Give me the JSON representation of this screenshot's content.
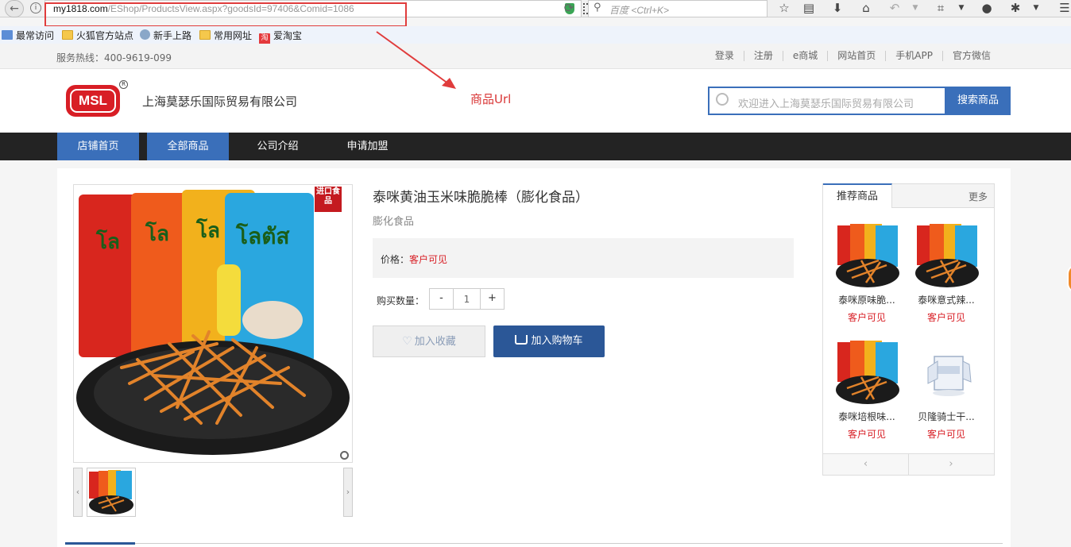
{
  "browser": {
    "url_host": "my1818.com",
    "url_path": "/EShop/ProductsView.aspx?goodsId=97406&Comid=1086",
    "search_placeholder": "百度 <Ctrl+K>"
  },
  "bookmarks": [
    {
      "label": "最常访问",
      "icon": "bookmark-icon"
    },
    {
      "label": "火狐官方站点",
      "icon": "folder-icon"
    },
    {
      "label": "新手上路",
      "icon": "globe-icon"
    },
    {
      "label": "常用网址",
      "icon": "folder-icon"
    },
    {
      "label": "爱淘宝",
      "icon": "taobao-icon"
    }
  ],
  "utility": {
    "hotline": "服务热线：400-9619-099",
    "links": [
      "登录",
      "注册",
      "e商城",
      "网站首页",
      "手机APP",
      "官方微信"
    ]
  },
  "header": {
    "logo_text": "MSL",
    "logo_reg": "R",
    "company_name": "上海莫瑟乐国际贸易有限公司",
    "annotation": "商品Url",
    "search_placeholder": "欢迎进入上海莫瑟乐国际贸易有限公司",
    "search_button": "搜索商品"
  },
  "nav": {
    "items": [
      "店铺首页",
      "全部商品",
      "公司介绍",
      "申请加盟"
    ],
    "active_index": 1
  },
  "product": {
    "badge": "进口食品",
    "title": "泰咪黄油玉米味脆脆棒（膨化食品）",
    "subtitle": "膨化食品",
    "price_label": "价格：",
    "price_value": "客户可见",
    "qty_label": "购买数量：",
    "qty_minus": "-",
    "qty_value": "1",
    "qty_plus": "+",
    "fav_button": "加入收藏",
    "cart_button": "加入购物车",
    "thumb_prev": "‹",
    "thumb_next": "›"
  },
  "recommend": {
    "tab": "推荐商品",
    "more": "更多",
    "items": [
      {
        "name": "泰咪原味脆...",
        "price": "客户可见"
      },
      {
        "name": "泰咪意式辣...",
        "price": "客户可见"
      },
      {
        "name": "泰咪培根味...",
        "price": "客户可见"
      },
      {
        "name": "贝隆骑士干...",
        "price": "客户可见"
      }
    ],
    "prev": "‹",
    "next": "›"
  },
  "colors": {
    "accent": "#3a6fba",
    "cart": "#2b5797",
    "price": "#d81e25",
    "nav_bg": "#232323",
    "annotation": "#d93636"
  }
}
